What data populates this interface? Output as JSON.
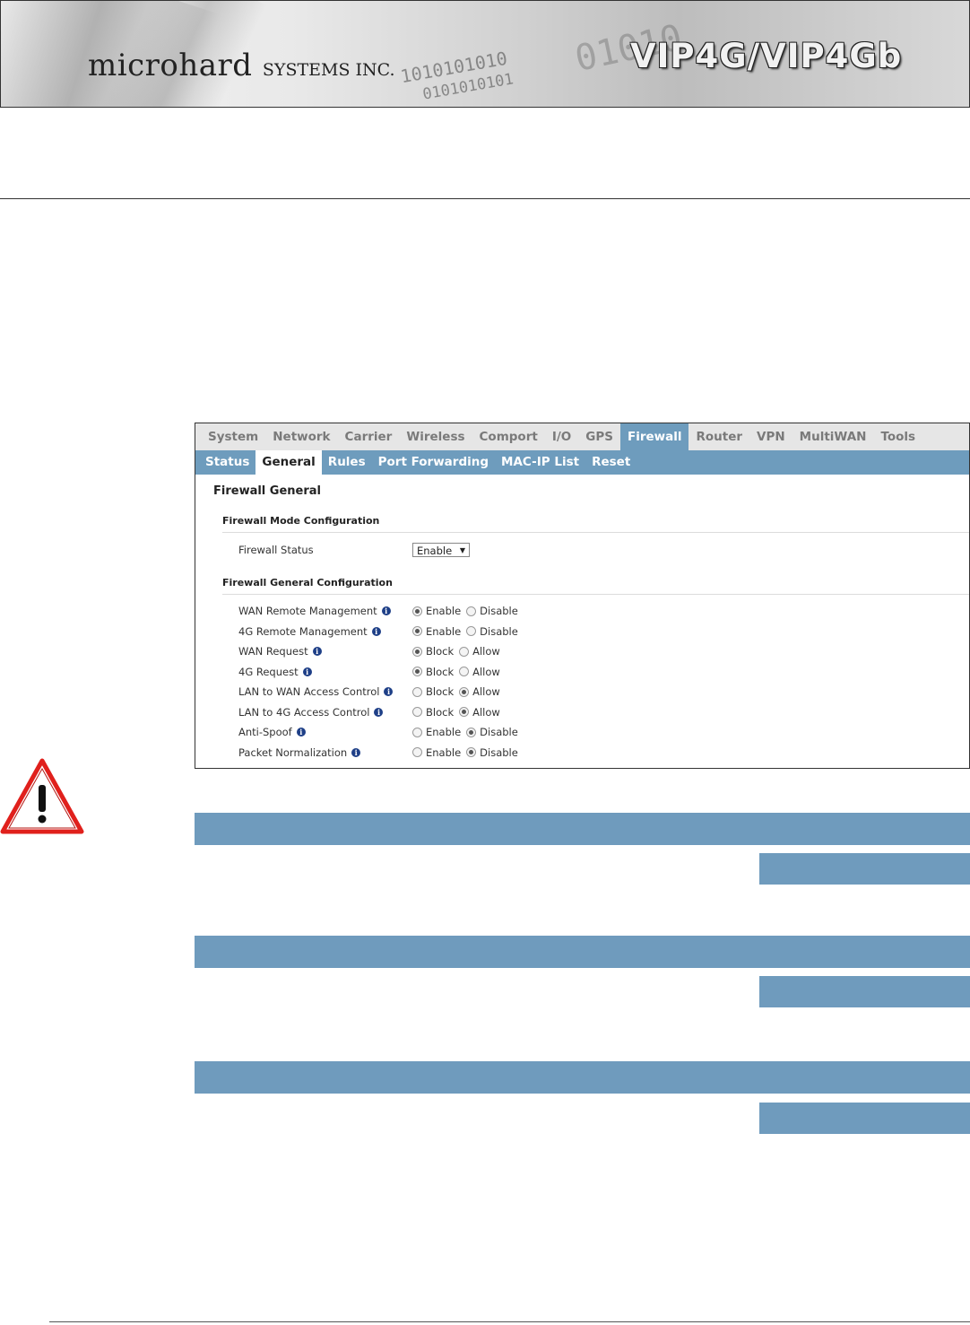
{
  "header": {
    "brand_main": "microhard",
    "brand_small": "SYSTEMS INC.",
    "product": "VIP4G/VIP4Gb",
    "binary_1": "1010101010",
    "binary_2": "0101010101",
    "binary_3": "01010"
  },
  "screenshot": {
    "top_tabs": [
      "System",
      "Network",
      "Carrier",
      "Wireless",
      "Comport",
      "I/O",
      "GPS",
      "Firewall",
      "Router",
      "VPN",
      "MultiWAN",
      "Tools"
    ],
    "active_top_tab": "Firewall",
    "sub_tabs": [
      "Status",
      "General",
      "Rules",
      "Port Forwarding",
      "MAC-IP List",
      "Reset"
    ],
    "active_sub_tab": "General",
    "page_title": "Firewall General",
    "section_mode": "Firewall Mode Configuration",
    "firewall_status_label": "Firewall Status",
    "firewall_status_value": "Enable",
    "section_general": "Firewall General Configuration",
    "rows": [
      {
        "label": "WAN Remote Management",
        "options": [
          "Enable",
          "Disable"
        ],
        "selected": 0
      },
      {
        "label": "4G Remote Management",
        "options": [
          "Enable",
          "Disable"
        ],
        "selected": 0
      },
      {
        "label": "WAN Request",
        "options": [
          "Block",
          "Allow"
        ],
        "selected": 0
      },
      {
        "label": "4G Request",
        "options": [
          "Block",
          "Allow"
        ],
        "selected": 0
      },
      {
        "label": "LAN to WAN Access Control",
        "options": [
          "Block",
          "Allow"
        ],
        "selected": 1
      },
      {
        "label": "LAN to 4G Access Control",
        "options": [
          "Block",
          "Allow"
        ],
        "selected": 1
      },
      {
        "label": "Anti-Spoof",
        "options": [
          "Enable",
          "Disable"
        ],
        "selected": 1
      },
      {
        "label": "Packet Normalization",
        "options": [
          "Enable",
          "Disable"
        ],
        "selected": 1
      }
    ]
  },
  "colors": {
    "nav_blue": "#6e9cbd",
    "bar_blue": "#6f9bbd",
    "warning_red": "#e0201c"
  },
  "icons": {
    "warning": "warning-triangle-icon",
    "info": "info-icon"
  }
}
